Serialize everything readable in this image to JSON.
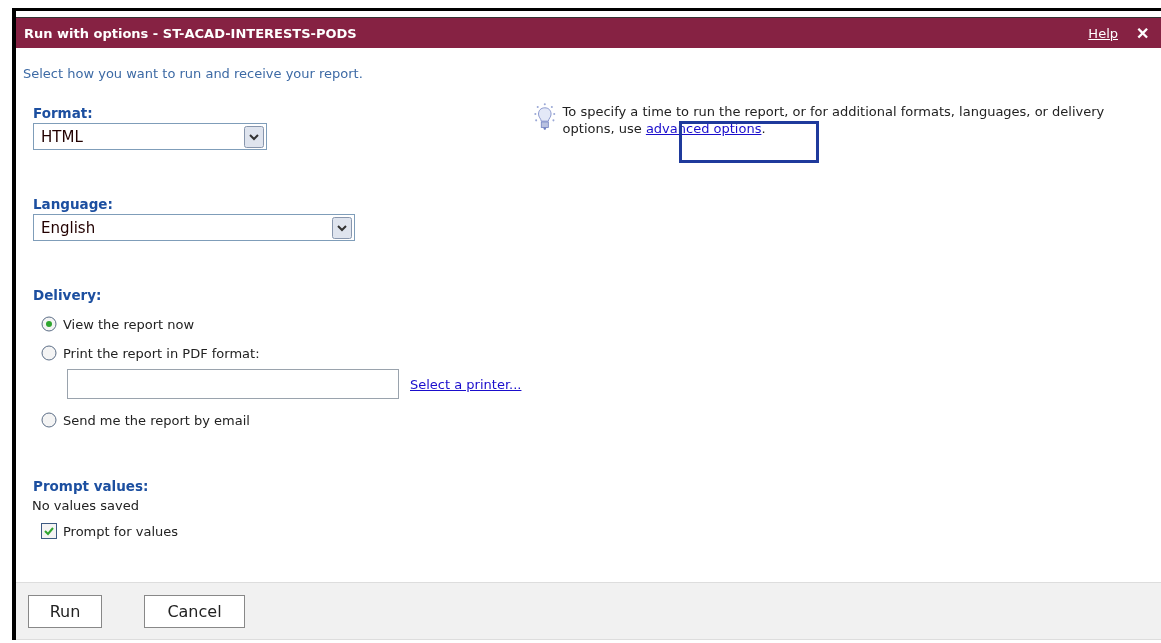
{
  "window": {
    "title": "Run with options - ST-ACAD-INTERESTS-PODS",
    "help_link": "Help",
    "close": "✕"
  },
  "intro": "Select how you want to run and receive your report.",
  "format": {
    "label": "Format:",
    "value": "HTML"
  },
  "language": {
    "label": "Language:",
    "value": "English"
  },
  "tip": {
    "text": "To specify a time to run the report, or for additional formats, languages, or delivery options, use ",
    "link": "advanced options",
    "end": "."
  },
  "delivery": {
    "label": "Delivery:",
    "options": [
      {
        "label": "View the report now",
        "selected": true
      },
      {
        "label": "Print the report in PDF format:",
        "selected": false,
        "kind": "printer"
      },
      {
        "label": "Send me the report by email",
        "selected": false
      }
    ],
    "printer_link": "Select a printer..."
  },
  "prompt": {
    "label": "Prompt values:",
    "status": "No values saved",
    "checkbox": {
      "label": "Prompt for values",
      "checked": true
    }
  },
  "buttons": [
    "Run",
    "Cancel"
  ]
}
